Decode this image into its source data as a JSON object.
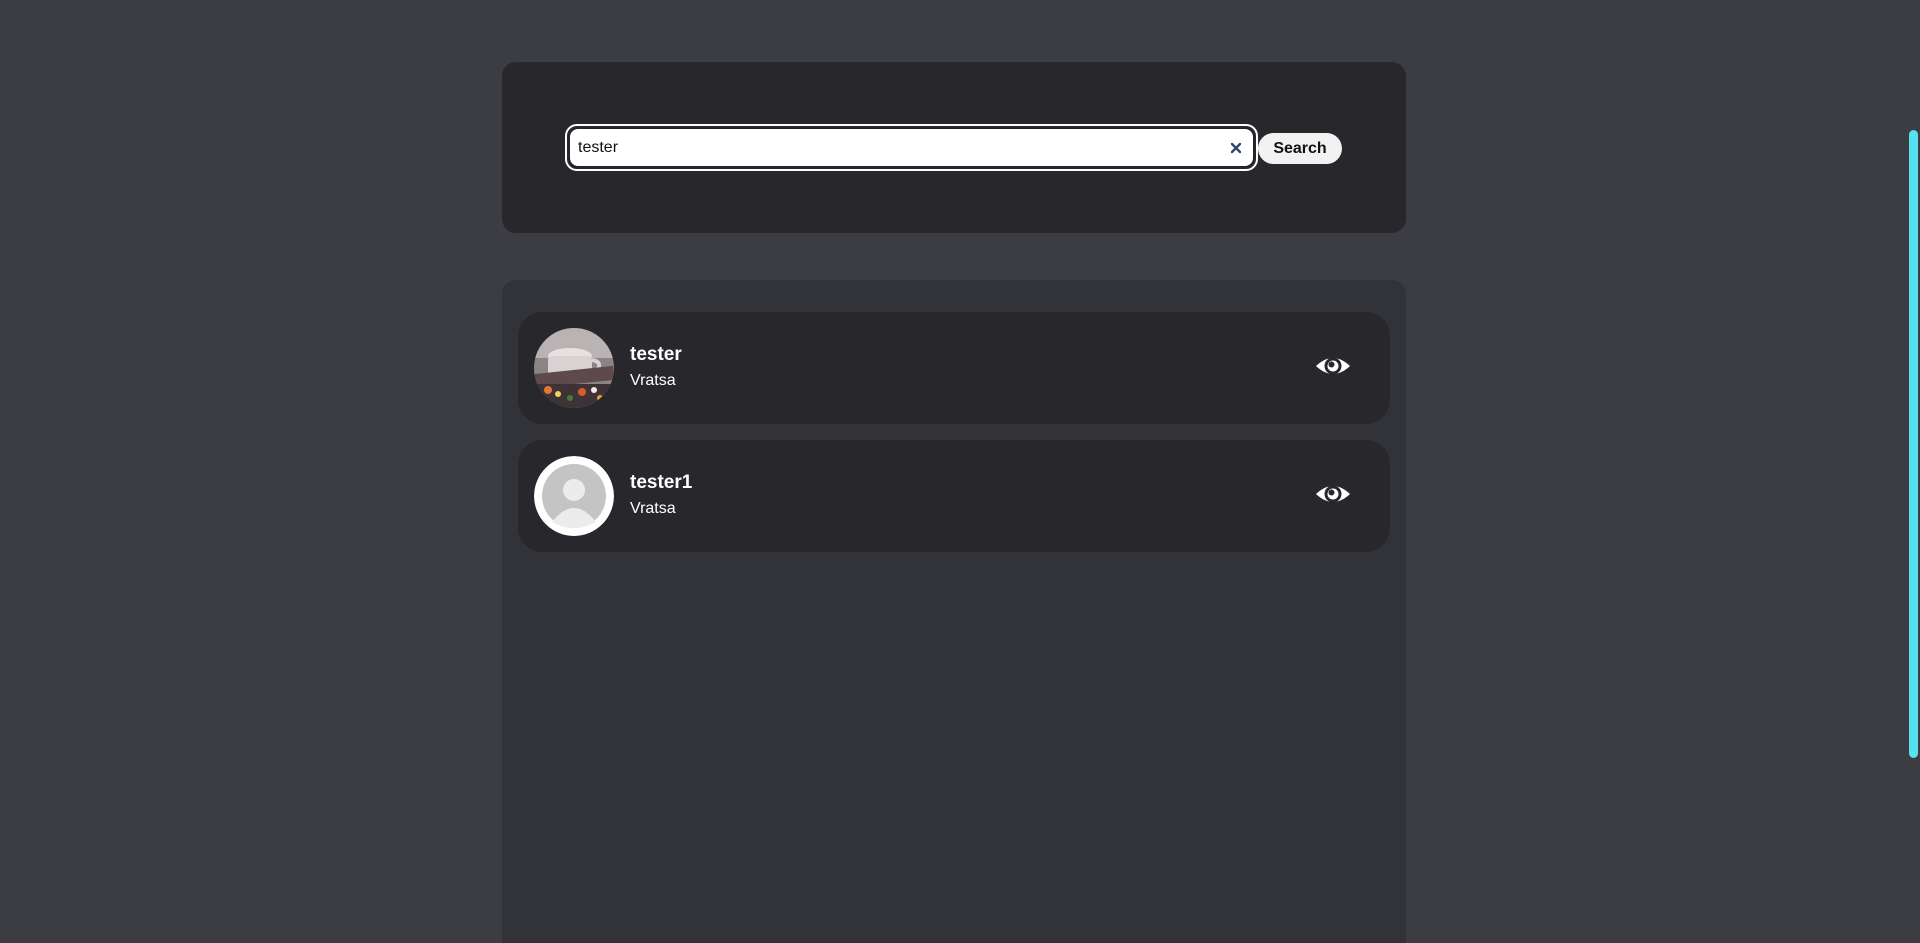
{
  "search": {
    "value": "tester",
    "button_label": "Search"
  },
  "results": [
    {
      "name": "tester",
      "city": "Vratsa",
      "avatar": "photo-avatar"
    },
    {
      "name": "tester1",
      "city": "Vratsa",
      "avatar": "default-avatar"
    }
  ],
  "icons": {
    "clear": "close-icon",
    "view": "eye-icon"
  },
  "colors": {
    "page_background": "#3c3d42",
    "panel_background": "#28282c",
    "results_background": "#323338",
    "scrollbar_accent": "#56e0f0"
  }
}
